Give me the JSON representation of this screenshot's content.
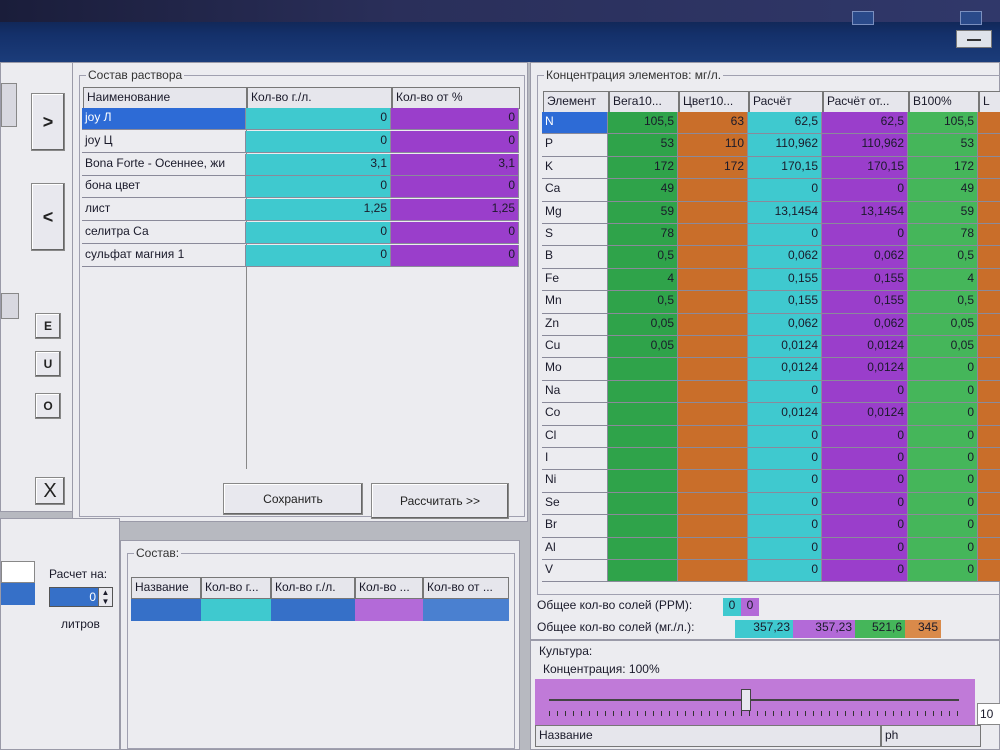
{
  "left_strip": {
    "move_right": ">",
    "move_left": "<",
    "btn_e": "E",
    "btn_u": "U",
    "btn_o": "O",
    "delete": "X"
  },
  "solution": {
    "title": "Состав раствора",
    "columns": [
      "Наименование",
      "Кол-во г./л.",
      "Кол-во от %"
    ],
    "rows": [
      {
        "name": "joy Л",
        "g": "0",
        "pct": "0"
      },
      {
        "name": "joy Ц",
        "g": "0",
        "pct": "0"
      },
      {
        "name": "Bona Forte - Осеннее, жи",
        "g": "3,1",
        "pct": "3,1"
      },
      {
        "name": "бона цвет",
        "g": "0",
        "pct": "0"
      },
      {
        "name": "лист",
        "g": "1,25",
        "pct": "1,25"
      },
      {
        "name": "селитра Са",
        "g": "0",
        "pct": "0"
      },
      {
        "name": "сульфат магния 1",
        "g": "0",
        "pct": "0"
      }
    ],
    "save_label": "Сохранить",
    "calc_label": "Рассчитать >>"
  },
  "bottom_left": {
    "calc_for_label": "Расчет на:",
    "calc_for_value": "0",
    "liters_label": "литров",
    "composition_title": "Состав:",
    "columns": [
      "Название",
      "Кол-во г...",
      "Кол-во г./л.",
      "Кол-во ...",
      "Кол-во от ..."
    ]
  },
  "concentration": {
    "title": "Концентрация элементов: мг/л.",
    "columns": [
      "Элемент",
      "Вега10...",
      "Цвет10...",
      "Расчёт",
      "Расчёт от...",
      "В100%",
      "L"
    ],
    "rows": [
      {
        "el": "N",
        "vega": "105,5",
        "cvet": "63",
        "calc": "62,5",
        "calc_pct": "62,5",
        "b100": "105,5"
      },
      {
        "el": "P",
        "vega": "53",
        "cvet": "110",
        "calc": "110,962",
        "calc_pct": "110,962",
        "b100": "53"
      },
      {
        "el": "K",
        "vega": "172",
        "cvet": "172",
        "calc": "170,15",
        "calc_pct": "170,15",
        "b100": "172"
      },
      {
        "el": "Ca",
        "vega": "49",
        "cvet": "",
        "calc": "0",
        "calc_pct": "0",
        "b100": "49"
      },
      {
        "el": "Mg",
        "vega": "59",
        "cvet": "",
        "calc": "13,1454",
        "calc_pct": "13,1454",
        "b100": "59"
      },
      {
        "el": "S",
        "vega": "78",
        "cvet": "",
        "calc": "0",
        "calc_pct": "0",
        "b100": "78"
      },
      {
        "el": "B",
        "vega": "0,5",
        "cvet": "",
        "calc": "0,062",
        "calc_pct": "0,062",
        "b100": "0,5"
      },
      {
        "el": "Fe",
        "vega": "4",
        "cvet": "",
        "calc": "0,155",
        "calc_pct": "0,155",
        "b100": "4"
      },
      {
        "el": "Mn",
        "vega": "0,5",
        "cvet": "",
        "calc": "0,155",
        "calc_pct": "0,155",
        "b100": "0,5"
      },
      {
        "el": "Zn",
        "vega": "0,05",
        "cvet": "",
        "calc": "0,062",
        "calc_pct": "0,062",
        "b100": "0,05"
      },
      {
        "el": "Cu",
        "vega": "0,05",
        "cvet": "",
        "calc": "0,0124",
        "calc_pct": "0,0124",
        "b100": "0,05"
      },
      {
        "el": "Mo",
        "vega": "",
        "cvet": "",
        "calc": "0,0124",
        "calc_pct": "0,0124",
        "b100": "0"
      },
      {
        "el": "Na",
        "vega": "",
        "cvet": "",
        "calc": "0",
        "calc_pct": "0",
        "b100": "0"
      },
      {
        "el": "Co",
        "vega": "",
        "cvet": "",
        "calc": "0,0124",
        "calc_pct": "0,0124",
        "b100": "0"
      },
      {
        "el": "Cl",
        "vega": "",
        "cvet": "",
        "calc": "0",
        "calc_pct": "0",
        "b100": "0"
      },
      {
        "el": "I",
        "vega": "",
        "cvet": "",
        "calc": "0",
        "calc_pct": "0",
        "b100": "0"
      },
      {
        "el": "Ni",
        "vega": "",
        "cvet": "",
        "calc": "0",
        "calc_pct": "0",
        "b100": "0"
      },
      {
        "el": "Se",
        "vega": "",
        "cvet": "",
        "calc": "0",
        "calc_pct": "0",
        "b100": "0"
      },
      {
        "el": "Br",
        "vega": "",
        "cvet": "",
        "calc": "0",
        "calc_pct": "0",
        "b100": "0"
      },
      {
        "el": "Al",
        "vega": "",
        "cvet": "",
        "calc": "0",
        "calc_pct": "0",
        "b100": "0"
      },
      {
        "el": "V",
        "vega": "",
        "cvet": "",
        "calc": "0",
        "calc_pct": "0",
        "b100": "0"
      }
    ],
    "ppm_label": "Общее кол-во солей (PPM):",
    "ppm_values": [
      "0",
      "0"
    ],
    "mgl_label": "Общее кол-во солей (мг./л.):",
    "mgl_values": [
      "357,23",
      "357,23",
      "521,6",
      "345"
    ]
  },
  "culture": {
    "title": "Культура:",
    "conc_label": "Концентрация: 100%",
    "slider_value_pct": 48,
    "slider_readout": "10",
    "table_columns": [
      "Название",
      "ph"
    ]
  },
  "colors": {
    "cyan": "#3fc9cf",
    "purple": "#9a3ecb",
    "green": "#2fa34a",
    "orange": "#c96e2a",
    "selection": "#2d6bd6"
  }
}
